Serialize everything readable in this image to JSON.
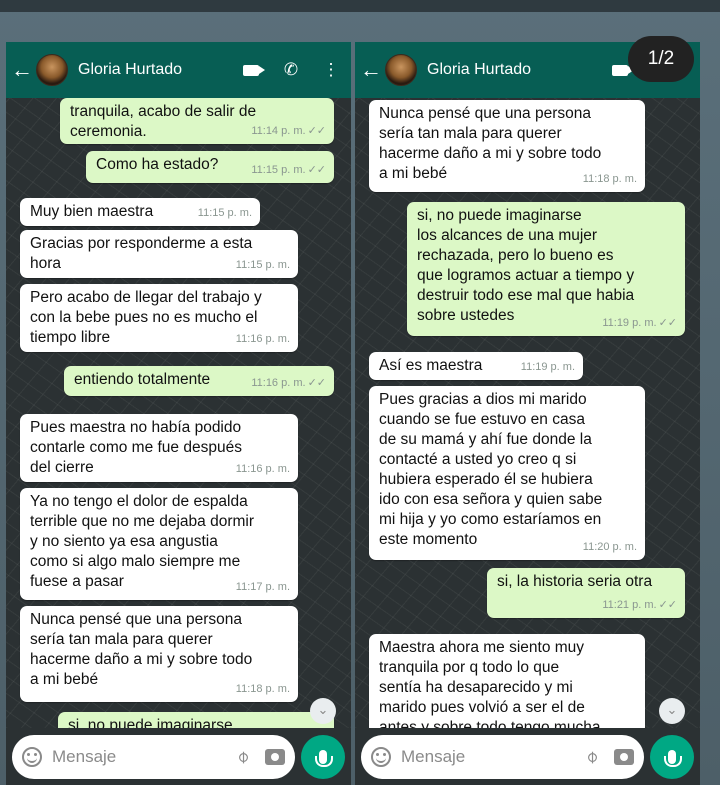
{
  "page_indicator": "1/2",
  "input_placeholder": "Mensaje",
  "colors": {
    "header": "#075e54",
    "bubble_out": "#dcf8c6",
    "bubble_in": "#ffffff",
    "mic": "#00a884"
  },
  "left": {
    "contact_name": "Gloria Hurtado",
    "messages": [
      {
        "dir": "out",
        "text": "tranquila, acabo de salir de\nceremonia.",
        "time": "11:14 p. m."
      },
      {
        "dir": "out",
        "text": "Como ha estado?",
        "time": "11:15 p. m."
      },
      {
        "dir": "in",
        "text": "Muy bien maestra",
        "time": "11:15 p. m."
      },
      {
        "dir": "in",
        "text": "Gracias por responderme a esta\nhora",
        "time": "11:15 p. m."
      },
      {
        "dir": "in",
        "text": "Pero acabo de llegar del trabajo y\ncon la bebe pues no es mucho el\ntiempo libre",
        "time": "11:16 p. m."
      },
      {
        "dir": "out",
        "text": "entiendo totalmente",
        "time": "11:16 p. m."
      },
      {
        "dir": "in",
        "text": "Pues maestra no había podido\ncontarle como me fue después\ndel cierre",
        "time": "11:16 p. m."
      },
      {
        "dir": "in",
        "text": "Ya no tengo el dolor de espalda\nterrible que no me dejaba dormir\ny no siento ya esa angustia\ncomo si algo malo siempre me\nfuese a pasar",
        "time": "11:17 p. m."
      },
      {
        "dir": "in",
        "text": "Nunca pensé que una persona\nsería tan mala para querer\nhacerme daño a mi y sobre todo\na mi bebé",
        "time": "11:18 p. m."
      },
      {
        "dir": "out",
        "text": "si, no puede imaginarse",
        "time": ""
      }
    ]
  },
  "right": {
    "contact_name": "Gloria Hurtado",
    "messages": [
      {
        "dir": "in",
        "text": "Nunca pensé que una persona\nsería tan mala para querer\nhacerme daño a mi y sobre todo\na mi bebé",
        "time": "11:18 p. m."
      },
      {
        "dir": "out",
        "text": "si, no puede imaginarse\nlos alcances de una mujer\nrechazada, pero lo bueno es\nque logramos actuar a tiempo y\ndestruir todo ese mal que habia\nsobre ustedes",
        "time": "11:19 p. m."
      },
      {
        "dir": "in",
        "text": "Así es maestra",
        "time": "11:19 p. m."
      },
      {
        "dir": "in",
        "text": "Pues gracias a dios mi marido\ncuando se fue estuvo en casa\nde su mamá y ahí fue donde la\ncontacté a usted yo creo q si\nhubiera esperado él se hubiera\nido con esa señora y quien sabe\nmi hija y yo como estaríamos en\neste momento",
        "time": "11:20 p. m."
      },
      {
        "dir": "out",
        "text": "si, la historia seria otra",
        "time": "11:21 p. m."
      },
      {
        "dir": "in",
        "text": "Maestra ahora me siento muy\ntranquila por q todo lo que\nsentía ha desaparecido y mi\nmarido pues volvió a ser el de\nantes y sobre todo tengo mucha",
        "time": ""
      }
    ]
  }
}
